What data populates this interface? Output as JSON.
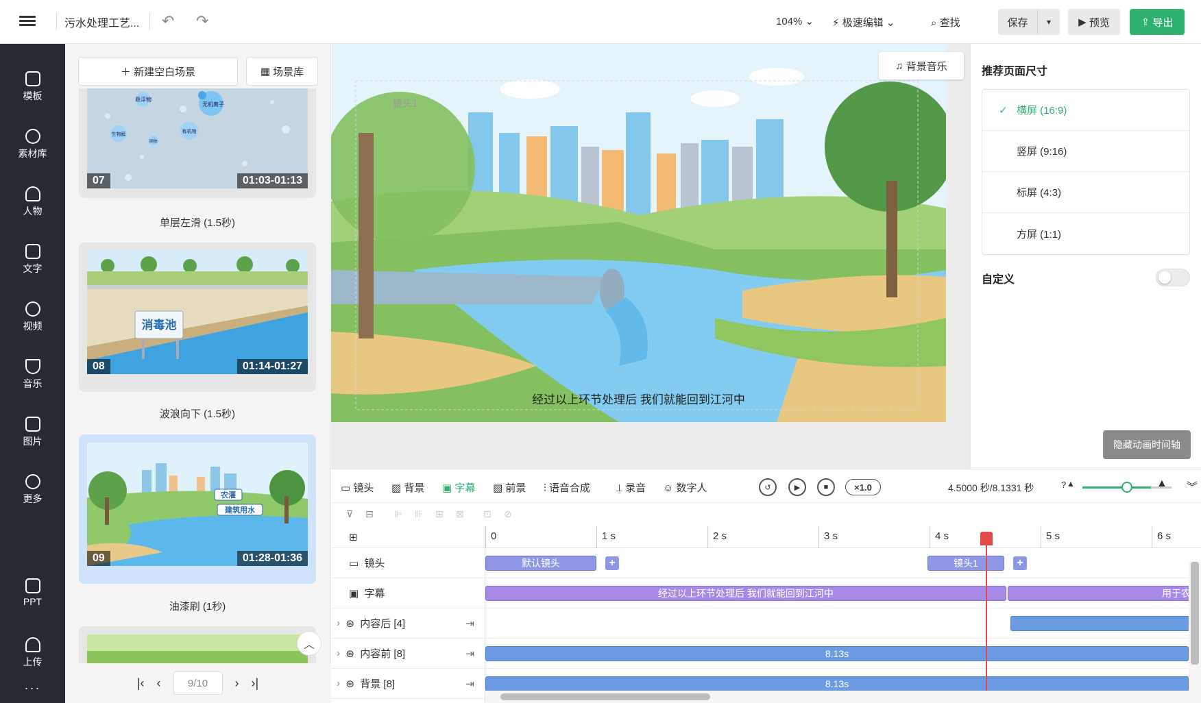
{
  "header": {
    "title": "污水处理工艺...",
    "zoom": "104%",
    "fast_edit": "极速编辑",
    "find": "查找",
    "save": "保存",
    "preview": "预览",
    "export": "导出"
  },
  "nav": [
    {
      "label": "模板",
      "icon": "template-icon"
    },
    {
      "label": "素材库",
      "icon": "assets-icon"
    },
    {
      "label": "人物",
      "icon": "person-icon"
    },
    {
      "label": "文字",
      "icon": "text-icon"
    },
    {
      "label": "视频",
      "icon": "video-icon"
    },
    {
      "label": "音乐",
      "icon": "music-icon"
    },
    {
      "label": "图片",
      "icon": "image-icon"
    },
    {
      "label": "更多",
      "icon": "more-icon"
    },
    {
      "label": "PPT",
      "icon": "ppt-icon"
    },
    {
      "label": "上传",
      "icon": "upload-icon"
    }
  ],
  "scenes": {
    "new_blank": "新建空白场景",
    "library": "场景库",
    "cards": [
      {
        "num": "07",
        "time": "01:03-01:13",
        "label": "单层左滑 (1.5秒)"
      },
      {
        "num": "08",
        "time": "01:14-01:27",
        "label": "波浪向下 (1.5秒)",
        "sign": "消毒池"
      },
      {
        "num": "09",
        "time": "01:28-01:36",
        "label": "油漆刷 (1秒)",
        "tag1": "农灌",
        "tag2": "建筑用水"
      }
    ],
    "bubbles": [
      "无机离子",
      "生物膜",
      "有机物",
      "悬浮物",
      "固体"
    ],
    "pager": "9/10"
  },
  "canvas": {
    "bgm": "背景音乐",
    "subtitle": "经过以上环节处理后 我们就能回到江河中",
    "lens_label": "镜头1"
  },
  "right_panel": {
    "title": "推荐页面尺寸",
    "options": [
      "横屏 (16:9)",
      "竖屏 (9:16)",
      "标屏 (4:3)",
      "方屏 (1:1)"
    ],
    "selected": 0,
    "custom": "自定义",
    "custom_on": false,
    "tooltip": "隐藏动画时间轴"
  },
  "timeline": {
    "tabs": [
      "镜头",
      "背景",
      "字幕",
      "前景",
      "语音合成",
      "录音",
      "数字人"
    ],
    "active_tab": "字幕",
    "speed": "×1.0",
    "time": "4.5000 秒/8.1331 秒",
    "ruler": [
      "0",
      "1 s",
      "2 s",
      "3 s",
      "4 s",
      "5 s",
      "6 s"
    ],
    "rows": [
      {
        "label": "镜头"
      },
      {
        "label": "字幕"
      },
      {
        "label": "内容后 [4]"
      },
      {
        "label": "内容前 [8]"
      },
      {
        "label": "背景 [8]"
      }
    ],
    "clips": {
      "default_lens": "默认镜头",
      "lens1": "镜头1",
      "subtitle1": "经过以上环节处理后 我们就能回到江河中",
      "subtitle2": "用于农灌",
      "front_len": "8.13s",
      "bg_len": "8.13s"
    }
  }
}
